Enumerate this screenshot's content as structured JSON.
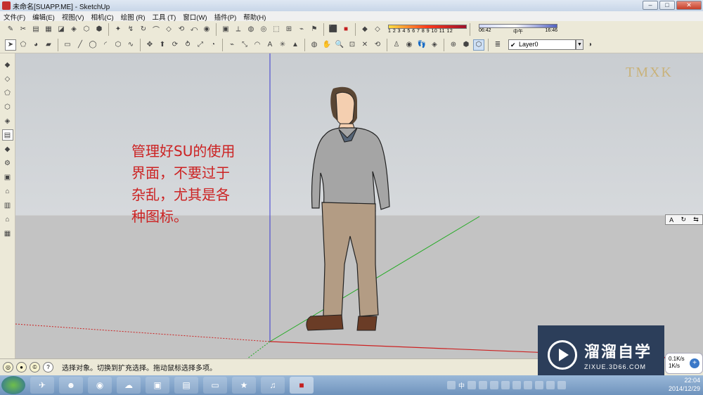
{
  "window": {
    "title": "未命名[SUAPP.ME] - SketchUp",
    "minimize": "–",
    "maximize": "□",
    "close": "✕"
  },
  "menu": [
    "文件(F)",
    "编辑(E)",
    "视图(V)",
    "相机(C)",
    "绘图 (R)",
    "工具 (T)",
    "窗口(W)",
    "插件(P)",
    "帮助(H)"
  ],
  "toolbar": {
    "fog_scale_label": "1 2 3 4 5 6 7 8 9 10 11 12",
    "shadow_time_start": "06:42",
    "shadow_time_mid": "中午",
    "shadow_time_end": "16:46",
    "layer": "Layer0",
    "layer_check": "✔"
  },
  "canvas": {
    "watermark": "TMXK",
    "note_lines": [
      "管理好SU的使用",
      "界面，不要过于",
      "杂乱，尤其是各",
      "种图标。"
    ],
    "mini_panel": [
      "A",
      "↻",
      "⇆"
    ]
  },
  "status": {
    "message": "选择对象。切换到扩充选择。拖动鼠标选择多项。"
  },
  "brand": {
    "name": "溜溜自学",
    "url": "ZIXUE.3D66.COM"
  },
  "netspeed": {
    "up": "0.1K/s",
    "down": "1K/s",
    "plus": "+"
  },
  "taskbar": {
    "tray_lang": "中",
    "time": "22:04",
    "date": "2014/12/29"
  },
  "colors": {
    "axis_blue": "#3a3ad0",
    "axis_green": "#22aa22",
    "axis_red": "#cc2222",
    "note_red": "#cc2222",
    "brand_bg": "#2c3e5a"
  }
}
